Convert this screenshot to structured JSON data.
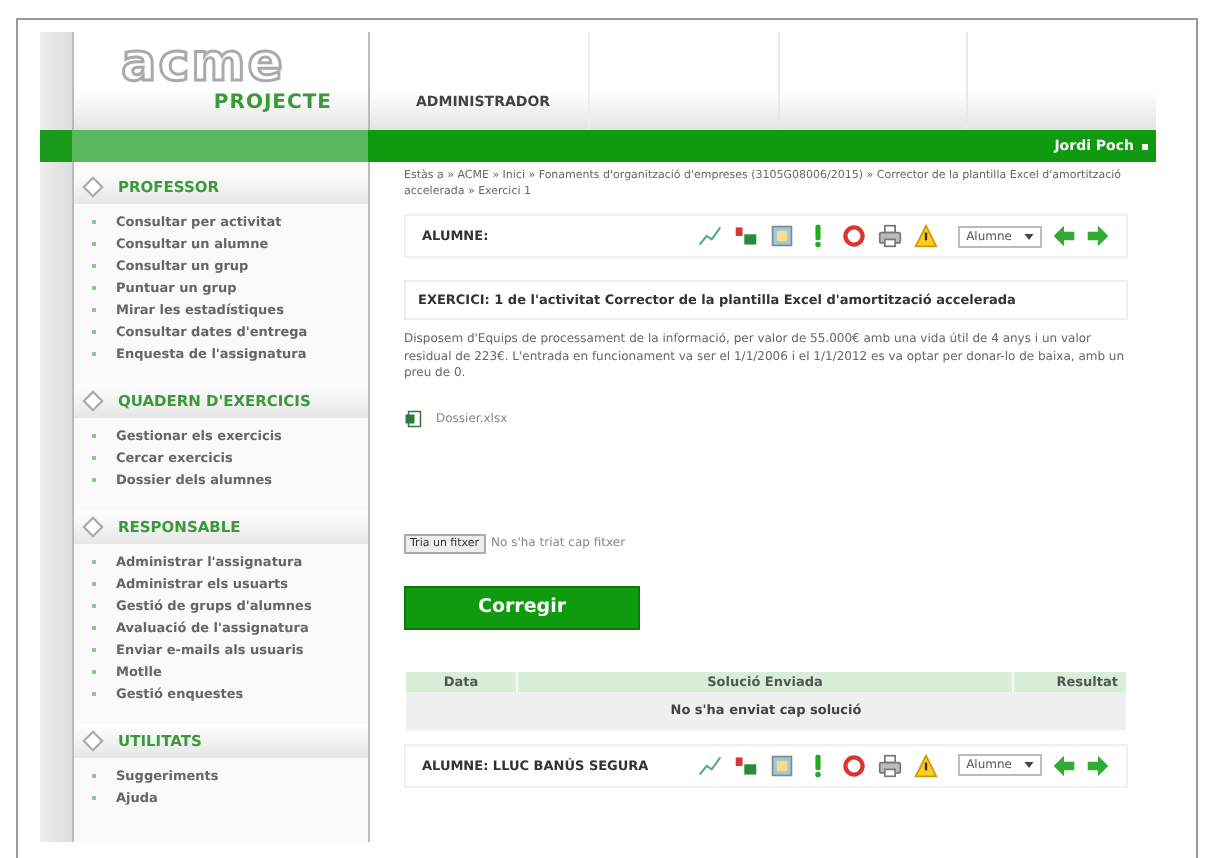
{
  "header": {
    "logo": "acme",
    "logo_subtitle": "PROJECTE",
    "nav": [
      "ADMINISTRADOR"
    ]
  },
  "user_bar": {
    "user": "Jordi Poch"
  },
  "sidebar": [
    {
      "title": "PROFESSOR",
      "items": [
        "Consultar per activitat",
        "Consultar un alumne",
        "Consultar un grup",
        "Puntuar un grup",
        "Mirar les estadístiques",
        "Consultar dates d'entrega",
        "Enquesta de l'assignatura"
      ]
    },
    {
      "title": "QUADERN D'EXERCICIS",
      "items": [
        "Gestionar els exercicis",
        "Cercar exercicis",
        "Dossier dels alumnes"
      ]
    },
    {
      "title": "RESPONSABLE",
      "items": [
        "Administrar l'assignatura",
        "Administrar els usuarts",
        "Gestió de grups d'alumnes",
        "Avaluació de l'assignatura",
        "Enviar e-mails als usuaris",
        "Motlle",
        "Gestió enquestes"
      ]
    },
    {
      "title": "UTILITATS",
      "items": [
        "Suggeriments",
        "Ajuda"
      ]
    }
  ],
  "breadcrumb": "Estàs a » ACME » Inici » Fonaments d'organització d'empreses (3105G08006/2015) » Corrector de la plantilla Excel d'amortització accelerada » Exercici 1",
  "toolbars": [
    {
      "label": "ALUMNE:",
      "select": "Alumne"
    },
    {
      "label": "ALUMNE: LLUC BANÚS SEGURA",
      "select": "Alumne"
    }
  ],
  "exercise": {
    "title": "EXERCICI: 1 de l'activitat Corrector de la plantilla Excel d'amortització accelerada",
    "description": "Disposem d'Equips de processament de la informació, per valor de 55.000€ amb una vida útil de 4 anys i un valor residual de 223€. L'entrada en funcionament va ser el 1/1/2006 i el 1/1/2012 es va optar per donar-lo de baixa, amb un preu de 0.",
    "attachment": "Dossier.xlsx"
  },
  "upload": {
    "button": "Tria un fitxer",
    "status": "No s'ha triat cap fitxer"
  },
  "submit": "Corregir",
  "table": {
    "columns": [
      "Data",
      "Solució Enviada",
      "Resultat"
    ],
    "empty": "No s'ha enviat cap solució"
  }
}
